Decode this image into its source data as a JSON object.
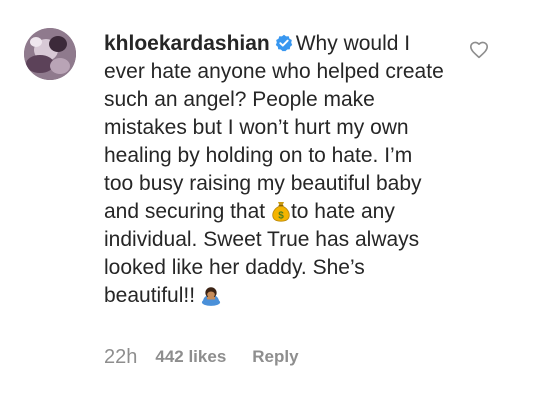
{
  "comment": {
    "username": "khloekardashian",
    "text_1": "Why would I ever hate anyone who helped create such an angel? People make mistakes but I won’t hurt my own healing by holding on to hate. I’m too busy raising my beautiful baby and securing that ",
    "text_2": "to hate any individual. Sweet True has always looked like her daddy. She’s beautiful!! ",
    "emoji_1": "money-bag-icon",
    "emoji_2": "woman-bowing-icon",
    "verified": "verified-badge-icon",
    "time": "22h",
    "likes": "442 likes",
    "reply_label": "Reply"
  },
  "colors": {
    "text": "#262626",
    "meta": "#8e8e8e",
    "verified": "#3897f0"
  }
}
